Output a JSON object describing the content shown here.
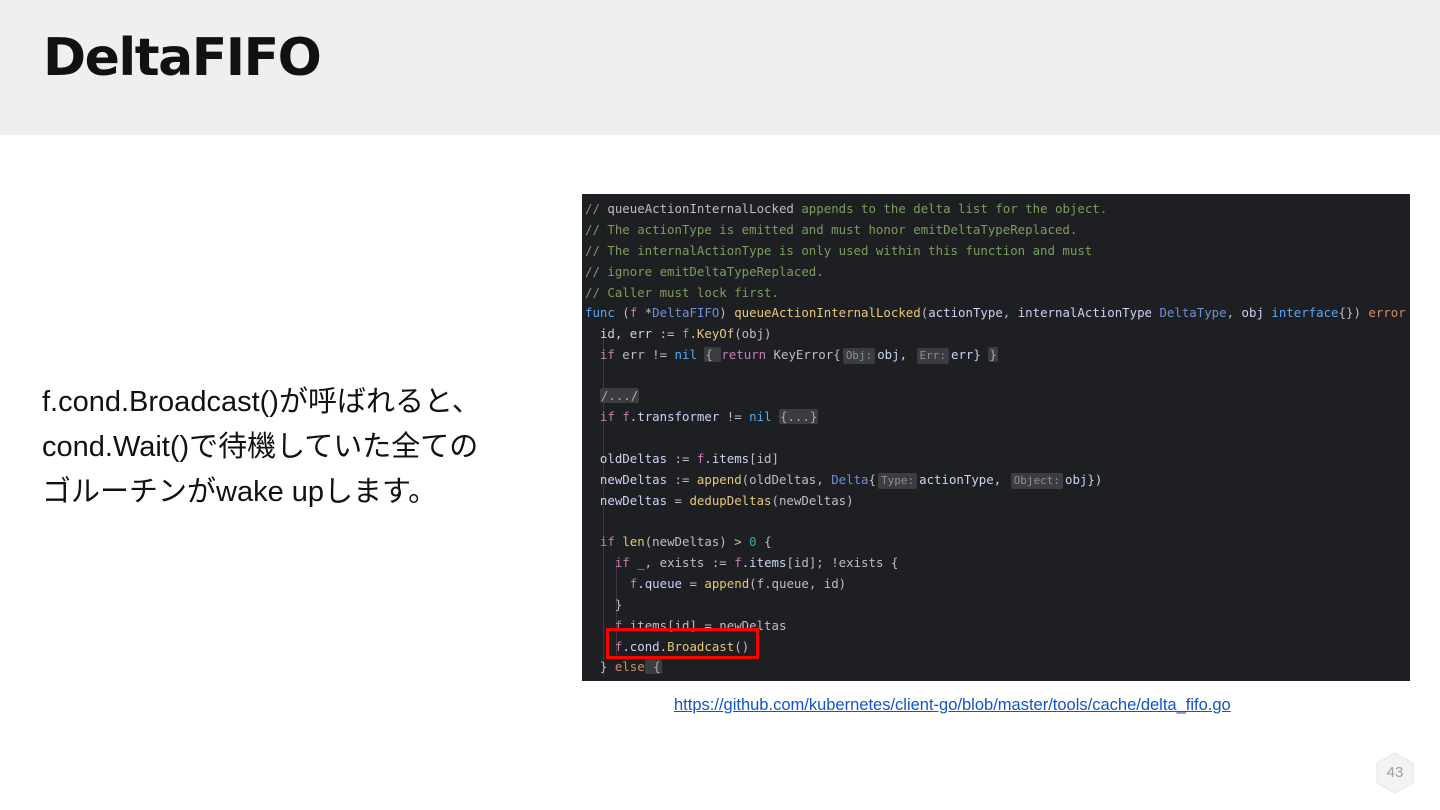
{
  "slide": {
    "title": "DeltaFIFO",
    "body_lines": [
      "f.cond.Broadcast()が呼ばれると、",
      "cond.Wait()で待機していた全ての",
      "ゴルーチンがwake upします。"
    ],
    "source_link": "https://github.com/kubernetes/client-go/blob/master/tools/cache/delta_fifo.go",
    "page_number": "43"
  },
  "code": {
    "c1a": "// queueActionInternalLocked appends to the delta list for the object.",
    "c2a": "// The actionType is emitted and must honor emitDeltaTypeReplaced.",
    "c3a": "// The internalActionType is only used within this function and must",
    "c4a": "// ignore emitDeltaTypeReplaced.",
    "c5a": "// Caller must lock first.",
    "func_kw": "func",
    "recv_open": " (",
    "recv_f": "f",
    "recv_ptr": " *",
    "recv_type": "DeltaFIFO",
    "recv_close": ") ",
    "func_name": "queueActionInternalLocked",
    "params_open": "(",
    "p1": "actionType",
    "comma": ", ",
    "p2": "internalActionType",
    "p2_type": " DeltaType",
    "p3": "obj",
    "p3_type": " interface",
    "params_close": "{}) ",
    "ret_type": "error",
    "open_brace": " {",
    "l7_vars": "id, err",
    "assign": " := ",
    "l7_f": "f",
    "l7_call": ".KeyOf",
    "l7_args": "(obj)",
    "if_kw": "if",
    "l8_cond": " err != ",
    "nil_kw": "nil",
    "fold_open": "{ ",
    "return_kw": "return",
    "l8_keyerr": " KeyError{",
    "hint_obj": "Obj:",
    "l8_obj": "obj, ",
    "hint_err": "Err:",
    "l8_err": "err} ",
    "fold_close": "}",
    "fold_comment": "/.../",
    "l11_tf": ".transformer",
    "l11_neq": " != ",
    "fold_dots": "{...}",
    "old_deltas": "oldDeltas",
    "l13_items": ".items",
    "l13_idx": "[id]",
    "new_deltas": "newDeltas",
    "append_fn": "append",
    "l14_args": "(oldDeltas, ",
    "delta_type": "Delta",
    "brace_open": "{",
    "hint_type": "Type:",
    "l14_at": "actionType, ",
    "hint_object": "Object:",
    "l14_obj": "obj})",
    "eq": " = ",
    "dedup_fn": "dedupDeltas",
    "l15_args": "(newDeltas)",
    "len_fn": "len",
    "l17_arg": "(newDeltas) > ",
    "zero": "0",
    "l18_vars": " _, exists",
    "l18_idx": "[id]; !exists {",
    "l19_queue": ".queue",
    "l19_args": "(f.queue, id)",
    "close_brace": "}",
    "l21_rest": ".items[id] = newDeltas",
    "l22_cond": ".cond",
    "broadcast_fn": ".Broadcast",
    "call_parens": "()",
    "l23_close": "} ",
    "else_kw": "else",
    "l23_open": " {"
  },
  "colors": {
    "header_bg": "#efefef",
    "code_bg": "#1e1f22",
    "highlight_border": "#ff0000",
    "link": "#1155cc"
  },
  "icons": {
    "page_badge": "hexagon-icon"
  }
}
